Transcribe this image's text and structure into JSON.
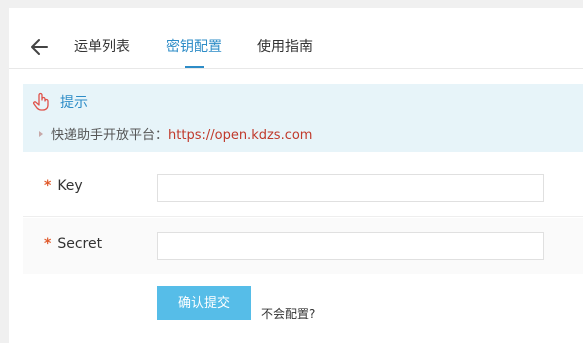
{
  "tabs": [
    {
      "label": "运单列表",
      "active": false
    },
    {
      "label": "密钥配置",
      "active": true
    },
    {
      "label": "使用指南",
      "active": false
    }
  ],
  "notice": {
    "icon": "hand-pointer-icon",
    "title": "提示",
    "text": "快递助手开放平台：",
    "link": "https://open.kdzs.com"
  },
  "form": {
    "required_mark": "*",
    "key_label": "Key",
    "key_value": "",
    "secret_label": "Secret",
    "secret_value": ""
  },
  "actions": {
    "submit_label": "确认提交",
    "help_label": "不会配置?"
  },
  "colors": {
    "accent": "#2d8cc7",
    "button": "#56bde8",
    "link": "#c0392b",
    "notice_bg": "#e7f4f9"
  }
}
